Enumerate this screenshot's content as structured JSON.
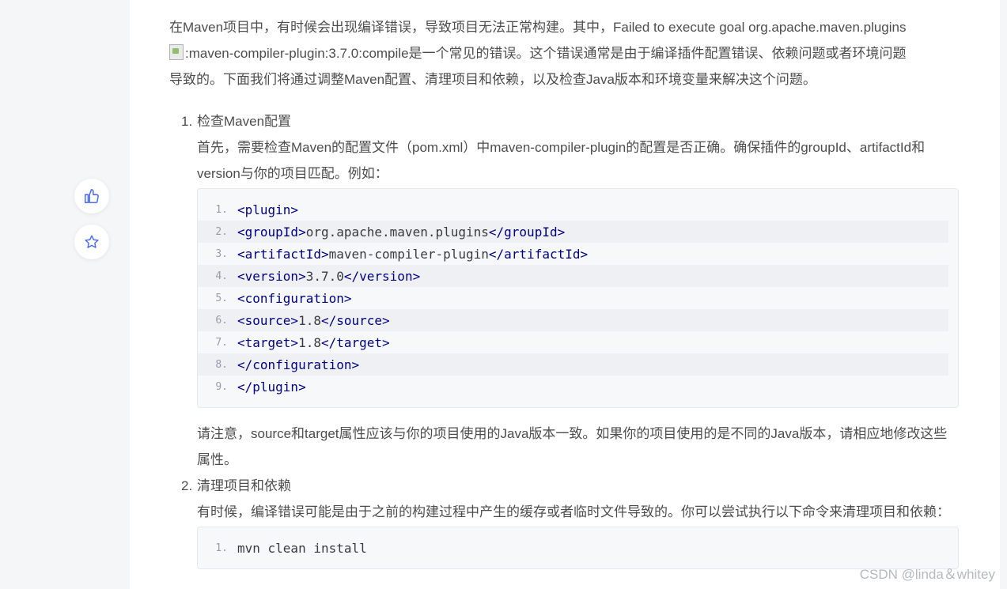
{
  "intro": "在Maven项目中，有时候会出现编译错误，导致项目无法正常构建。其中，Failed to execute goal org.apache.maven.plugins",
  "intro2": ":maven-compiler-plugin:3.7.0:compile是一个常见的错误。这个错误通常是由于编译插件配置错误、依赖问题或者环境问题",
  "intro3": "导致的。下面我们将通过调整Maven配置、清理项目和依赖，以及检查Java版本和环境变量来解决这个问题。",
  "sidebar": {
    "like_icon": "thumbs-up-icon",
    "star_icon": "star-icon"
  },
  "steps": [
    {
      "num": "1.",
      "title": "检查Maven配置",
      "desc": "首先，需要检查Maven的配置文件（pom.xml）中maven-compiler-plugin的配置是否正确。确保插件的groupId、artifactId和version与你的项目匹配。例如：",
      "code": [
        {
          "ln": "1.",
          "open": "<plugin>",
          "text": "",
          "close": ""
        },
        {
          "ln": "2.",
          "open": "<groupId>",
          "text": "org.apache.maven.plugins",
          "close": "</groupId>"
        },
        {
          "ln": "3.",
          "open": "<artifactId>",
          "text": "maven-compiler-plugin",
          "close": "</artifactId>"
        },
        {
          "ln": "4.",
          "open": "<version>",
          "text": "3.7.0",
          "close": "</version>"
        },
        {
          "ln": "5.",
          "open": "<configuration>",
          "text": "",
          "close": ""
        },
        {
          "ln": "6.",
          "open": "<source>",
          "text": "1.8",
          "close": "</source>"
        },
        {
          "ln": "7.",
          "open": "<target>",
          "text": "1.8",
          "close": "</target>"
        },
        {
          "ln": "8.",
          "open": "</configuration>",
          "text": "",
          "close": ""
        },
        {
          "ln": "9.",
          "open": "</plugin>",
          "text": "",
          "close": ""
        }
      ],
      "note": "请注意，source和target属性应该与你的项目使用的Java版本一致。如果你的项目使用的是不同的Java版本，请相应地修改这些属性。"
    },
    {
      "num": "2.",
      "title": "清理项目和依赖",
      "desc": "有时候，编译错误可能是由于之前的构建过程中产生的缓存或者临时文件导致的。你可以尝试执行以下命令来清理项目和依赖：",
      "code": [
        {
          "ln": "1.",
          "open": "",
          "text": "mvn clean install",
          "close": ""
        }
      ]
    }
  ],
  "watermark": "CSDN @linda＆whitey"
}
